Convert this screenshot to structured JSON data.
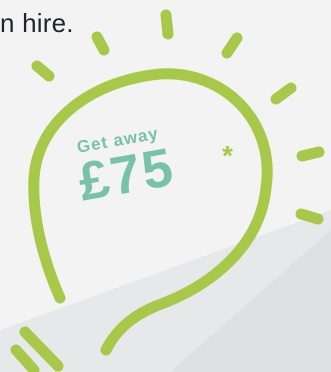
{
  "header": {
    "text_fragment": "n hire."
  },
  "promo": {
    "small_text": "Get away",
    "amount": "£75",
    "asterisk": "*"
  },
  "colors": {
    "bulb_green": "#a8c84a",
    "promo_teal": "#78c2aa",
    "text_dark": "#222428",
    "bg_light": "#f2f2f3",
    "bg_shade": "#e2e3e4"
  },
  "icons": [
    "lightbulb-icon"
  ]
}
